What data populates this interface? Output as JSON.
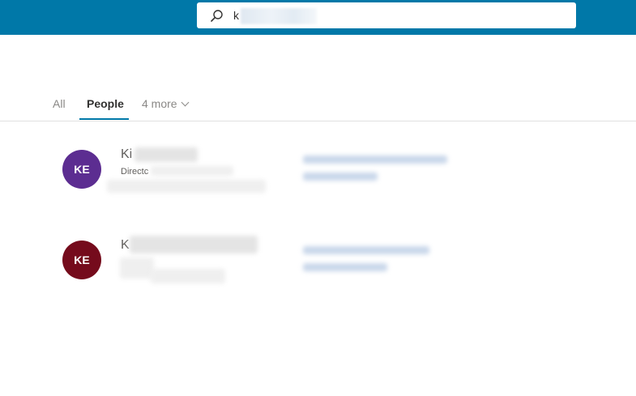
{
  "search": {
    "value": "k"
  },
  "tabs": [
    {
      "label": "All"
    },
    {
      "label": "People"
    },
    {
      "label": "4 more"
    }
  ],
  "people": [
    {
      "initials": "KE",
      "avatar_color": "#5c2d91",
      "name": "Ki",
      "subtitle": "Directc"
    },
    {
      "initials": "KE",
      "avatar_color": "#750b1c",
      "name": "K",
      "subtitle": ""
    }
  ],
  "colors": {
    "header": "#0078a8",
    "accent": "#0078a8"
  }
}
